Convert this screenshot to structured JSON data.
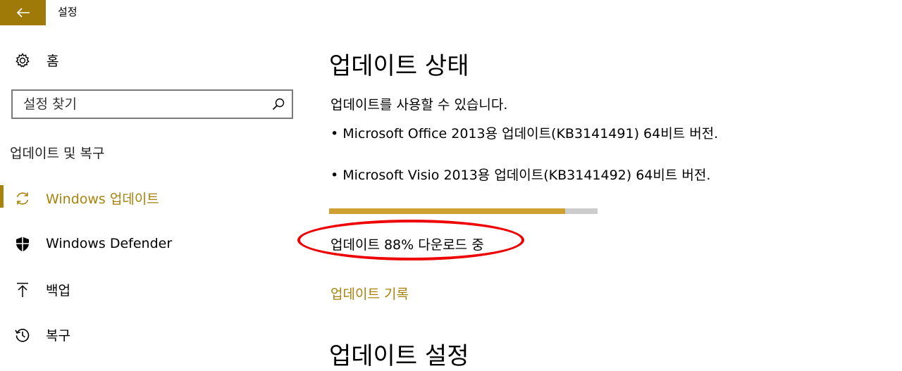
{
  "window": {
    "title": "설정"
  },
  "sidebar": {
    "home_label": "홈",
    "search_placeholder": "설정 찾기",
    "section_heading": "업데이트 및 복구",
    "items": [
      {
        "label": "Windows 업데이트",
        "icon": "sync-icon",
        "active": true
      },
      {
        "label": "Windows Defender",
        "icon": "shield-icon",
        "active": false
      },
      {
        "label": "백업",
        "icon": "upload-arrow-icon",
        "active": false
      },
      {
        "label": "복구",
        "icon": "history-icon",
        "active": false
      }
    ]
  },
  "main": {
    "status_heading": "업데이트 상태",
    "status_text": "업데이트를 사용할 수 있습니다.",
    "updates": [
      "• Microsoft Office 2013용 업데이트(KB3141491) 64비트 버전.",
      "• Microsoft Visio 2013용 업데이트(KB3141492) 64비트 버전."
    ],
    "progress_percent": 88,
    "download_status": "업데이트 88% 다운로드 중",
    "history_link": "업데이트 기록",
    "settings_heading": "업데이트 설정"
  },
  "colors": {
    "accent": "#a8820a",
    "back_button": "#a07a08",
    "progress_fill": "#cfa032",
    "annotation": "#ee0000"
  }
}
